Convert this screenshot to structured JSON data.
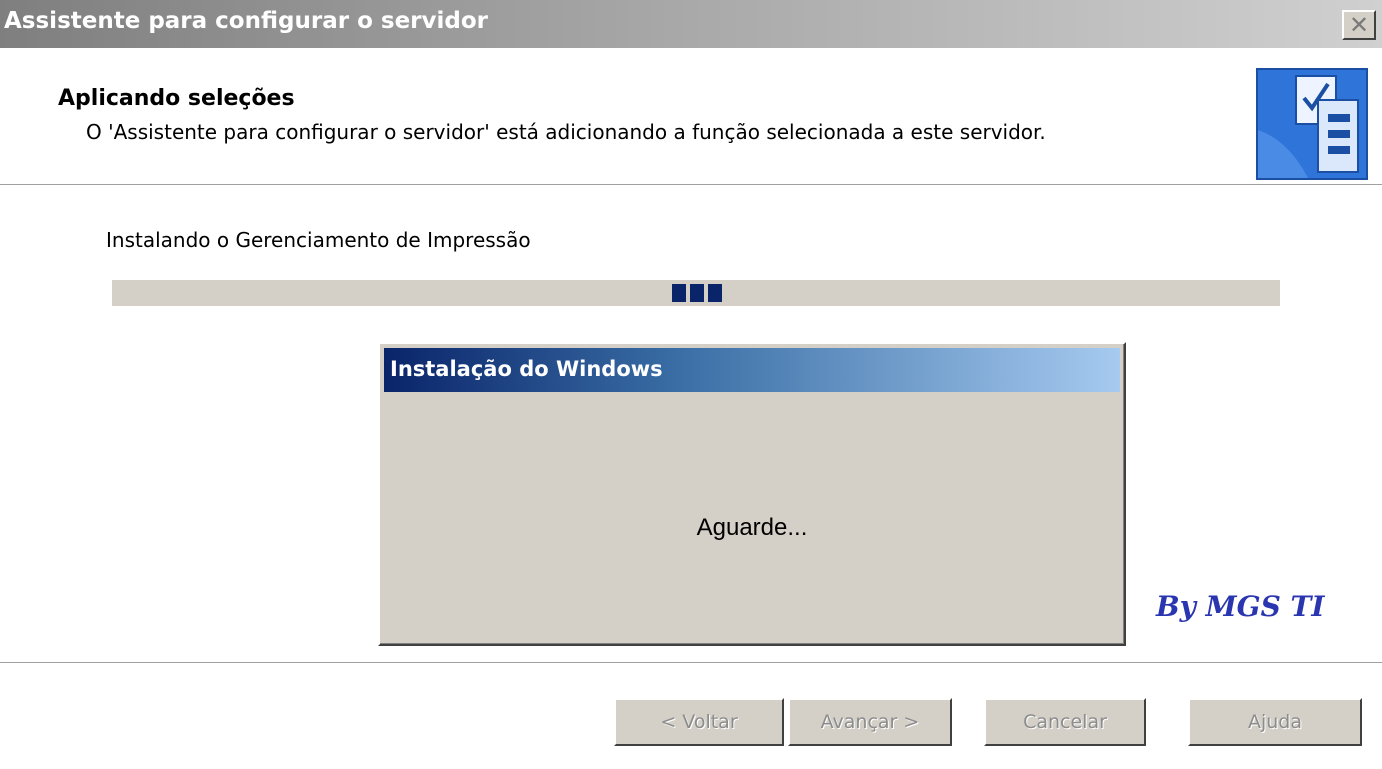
{
  "window": {
    "title": "Assistente para configurar o servidor",
    "close_glyph": "✕"
  },
  "header": {
    "title": "Aplicando seleções",
    "subtitle": "O 'Assistente para configurar o servidor' está adicionando a função selecionada a este servidor.",
    "icon": "wizard-checklist-icon"
  },
  "status": {
    "text": "Instalando o Gerenciamento de Impressão",
    "progress_style": "marquee"
  },
  "inner_dialog": {
    "title": "Instalação do Windows",
    "message": "Aguarde..."
  },
  "watermark": {
    "text": "By MGS TI"
  },
  "buttons": {
    "back_label": "< Voltar",
    "next_label": "Avançar >",
    "cancel_label": "Cancelar",
    "help_label": "Ajuda"
  },
  "colors": {
    "dialog_face": "#d4d0c8",
    "progress_block": "#0a246a",
    "watermark": "#2a35b0"
  }
}
